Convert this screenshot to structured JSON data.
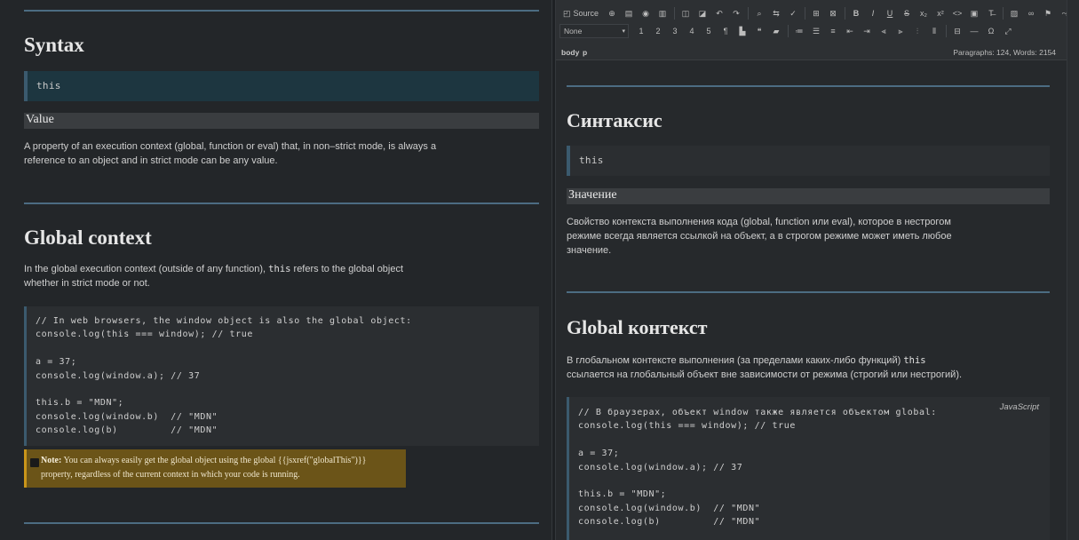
{
  "left": {
    "syntax_heading": "Syntax",
    "syntax_code": "this",
    "value_heading": "Value",
    "value_para_1": "A property of an execution context (global, function or eval) that, in non–strict mode, is always a",
    "value_para_2": "reference to an object and in strict mode can be any value.",
    "global_heading": "Global context",
    "global_para_1a": "In the global execution context (outside of any function), ",
    "global_para_1b": "this",
    "global_para_1c": " refers to the global object",
    "global_para_2": "whether in strict mode or not.",
    "code_lines": [
      "// In web browsers, the window object is also the global object:",
      "console.log(this === window); // true",
      "",
      "a = 37;",
      "console.log(window.a); // 37",
      "",
      "this.b = \"MDN\";",
      "console.log(window.b)  // \"MDN\"",
      "console.log(b)         // \"MDN\""
    ],
    "note_label": "Note:",
    "note_text_1": " You can always easily get the global object using the global {{jsxref(\"globalThis\")}}",
    "note_text_2": "property, regardless of the current context in which your code is running."
  },
  "right": {
    "toolbar": {
      "source_label": "Source",
      "format_select": "None"
    },
    "path": {
      "body": "body",
      "p": "p"
    },
    "stats": "Paragraphs: 124, Words: 2154",
    "syntax_heading": "Синтаксис",
    "syntax_code": "this",
    "value_heading": "Значение",
    "value_para_1": "Свойство контекста выполнения кода (global, function или eval), которое в нестрогом",
    "value_para_2": "режиме всегда является ссылкой на объект, а в строгом режиме может иметь любое",
    "value_para_3": "значение.",
    "global_heading": "Global контекст",
    "global_para_1a": "В глобальном контексте выполнения (за пределами каких-либо функций) ",
    "global_para_1b": "this",
    "global_para_2": "ссылается на глобальный объект вне зависимости от режима (строгий или нестрогий).",
    "code_lang": "JavaScript",
    "code_lines": [
      "// В браузерах, объект window также является объектом global:",
      "console.log(this === window); // true",
      "",
      "a = 37;",
      "console.log(window.a); // 37",
      "",
      "this.b = \"MDN\";",
      "console.log(window.b)  // \"MDN\"",
      "console.log(b)         // \"MDN\""
    ]
  }
}
